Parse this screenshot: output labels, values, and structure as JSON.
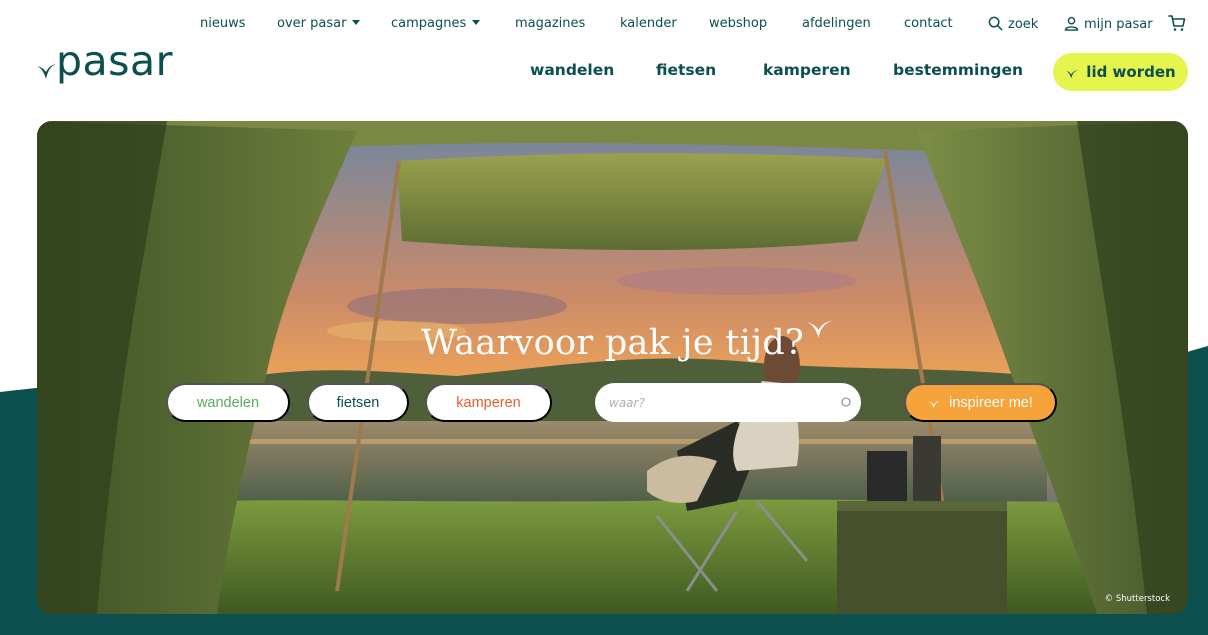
{
  "brand": {
    "name": "pasar",
    "colors": {
      "teal": "#0b4f4f",
      "lime": "#e6f54e",
      "orange": "#f5a33a",
      "green": "#5cab5c",
      "rust": "#e2612d"
    }
  },
  "topnav": {
    "items": [
      "nieuws",
      "over pasar",
      "campagnes",
      "magazines",
      "kalender",
      "webshop",
      "afdelingen",
      "contact"
    ],
    "search_label": "zoek",
    "account_label": "mijn pasar",
    "icons": {
      "search": "search-icon",
      "account": "user-icon",
      "cart": "cart-icon"
    }
  },
  "mainnav": {
    "items": [
      "wandelen",
      "fietsen",
      "kamperen",
      "bestemmingen"
    ],
    "join_label": "lid worden"
  },
  "hero": {
    "title": "Waarvoor pak je tijd?",
    "filters": [
      "wandelen",
      "fietsen",
      "kamperen"
    ],
    "search_placeholder": "waar?",
    "submit_label": "inspireer me!",
    "credit": "© Shutterstock"
  }
}
